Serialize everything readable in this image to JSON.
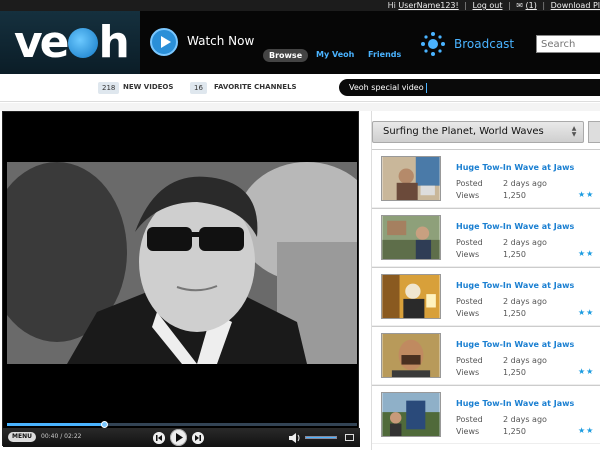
{
  "topbar": {
    "greeting": "Hi",
    "username": "UserName123!",
    "logout": "Log out",
    "messages": "(1)",
    "download": "Download Pl"
  },
  "header": {
    "logo": "veoh",
    "watch_now": "Watch Now",
    "browse": "Browse",
    "my_veoh": "My Veoh",
    "friends": "Friends",
    "broadcast": "Broadcast",
    "search_placeholder": "Search"
  },
  "subnav": {
    "new_videos_count": "218",
    "new_videos_label": "NEW VIDEOS",
    "favorite_channels_count": "16",
    "favorite_channels_label": "FAVORITE CHANNELS",
    "special_video": "Veoh special video"
  },
  "player": {
    "menu": "MENU",
    "elapsed": "00:40",
    "duration": "02:22",
    "separator": "/",
    "progress": 0.28,
    "volume": 1.0
  },
  "channel": {
    "title": "Surfing the Planet, World Waves",
    "items": [
      {
        "title": "Huge Tow-In Wave at Jaws",
        "posted_label": "Posted",
        "posted": "2 days ago",
        "views_label": "Views",
        "views": "1,250",
        "stars": "★★"
      },
      {
        "title": "Huge Tow-In Wave at Jaws",
        "posted_label": "Posted",
        "posted": "2 days ago",
        "views_label": "Views",
        "views": "1,250",
        "stars": "★★"
      },
      {
        "title": "Huge Tow-In Wave at Jaws",
        "posted_label": "Posted",
        "posted": "2 days ago",
        "views_label": "Views",
        "views": "1,250",
        "stars": "★★"
      },
      {
        "title": "Huge Tow-In Wave at Jaws",
        "posted_label": "Posted",
        "posted": "2 days ago",
        "views_label": "Views",
        "views": "1,250",
        "stars": "★★"
      },
      {
        "title": "Huge Tow-In Wave at Jaws",
        "posted_label": "Posted",
        "posted": "2 days ago",
        "views_label": "Views",
        "views": "1,250",
        "stars": "★★"
      }
    ]
  },
  "colors": {
    "accent": "#4ab3ff",
    "link": "#1a7fd1",
    "header_bg": "#060606"
  }
}
